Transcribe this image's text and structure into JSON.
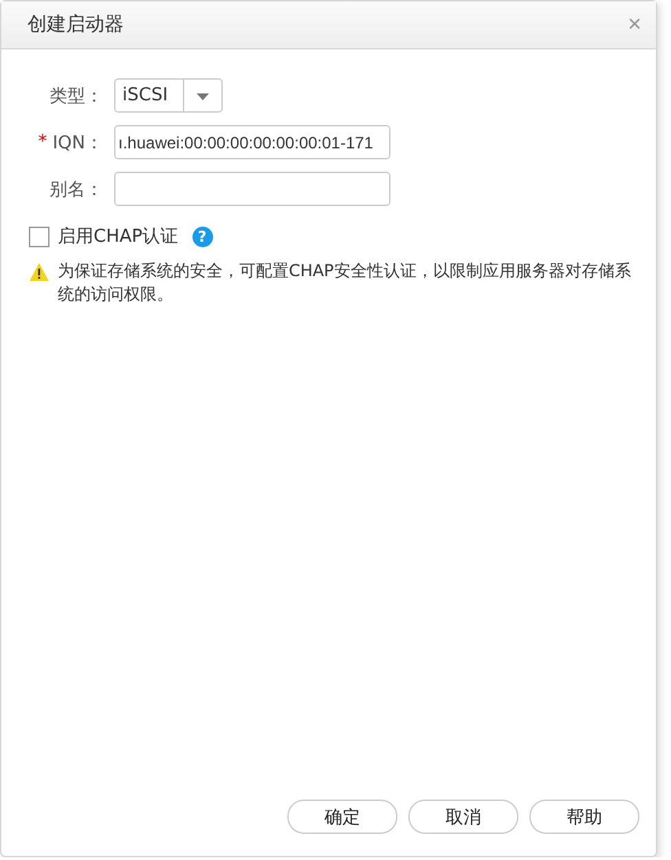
{
  "window": {
    "title": "创建启动器",
    "close": "✕"
  },
  "fields": [
    {
      "kind": "select",
      "label": "类型：",
      "required": false,
      "value": "iSCSI"
    },
    {
      "kind": "input",
      "label": "IQN：",
      "required": true,
      "value": "ı.huawei:00:00:00:00:00:00:01-171"
    },
    {
      "kind": "input",
      "label": "别名：",
      "required": false
    }
  ],
  "required_mark": "*",
  "chap": {
    "label": "启用CHAP认证",
    "checked": false,
    "help": "?"
  },
  "warning": "为保证存储系统的安全，可配置CHAP安全性认证，以限制应用服务器对存储系统的访问权限。",
  "buttons": [
    "确定",
    "取消",
    "帮助"
  ]
}
